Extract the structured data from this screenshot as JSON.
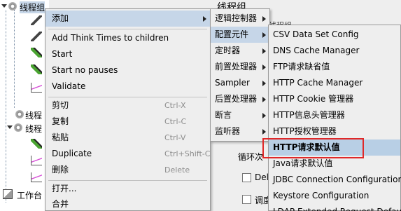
{
  "tree": {
    "top_node_label": "线程组",
    "node_2_label": "线程",
    "node_3_label": "线程",
    "workbench_label": "工作台"
  },
  "right_panel": {
    "title": "线程组",
    "name_label": "线程组",
    "loop_label": "循环次",
    "check_1_label": "Del",
    "check_2_label": "调度"
  },
  "main_menu": {
    "items": [
      {
        "label": "添加"
      },
      {
        "label": "Add Think Times to children"
      },
      {
        "label": "Start"
      },
      {
        "label": "Start no pauses"
      },
      {
        "label": "Validate"
      },
      {
        "label": "剪切",
        "shortcut": "Ctrl-X"
      },
      {
        "label": "复制",
        "shortcut": "Ctrl-C"
      },
      {
        "label": "粘贴",
        "shortcut": "Ctrl-V"
      },
      {
        "label": "Duplicate",
        "shortcut": "Ctrl+Shift-C"
      },
      {
        "label": "删除",
        "shortcut": "Delete"
      },
      {
        "label": "打开..."
      },
      {
        "label": "合并"
      }
    ]
  },
  "sub_menu": {
    "items": [
      {
        "label": "逻辑控制器"
      },
      {
        "label": "配置元件"
      },
      {
        "label": "定时器"
      },
      {
        "label": "前置处理器"
      },
      {
        "label": "Sampler"
      },
      {
        "label": "后置处理器"
      },
      {
        "label": "断言"
      },
      {
        "label": "监听器"
      }
    ]
  },
  "config_menu": {
    "items": [
      {
        "label": "CSV Data Set Config"
      },
      {
        "label": "DNS Cache Manager"
      },
      {
        "label": "FTP请求缺省值"
      },
      {
        "label": "HTTP Cache Manager"
      },
      {
        "label": "HTTP Cookie 管理器"
      },
      {
        "label": "HTTP信息头管理器"
      },
      {
        "label": "HTTP授权管理器"
      },
      {
        "label": "HTTP请求默认值"
      },
      {
        "label": "Java请求默认值"
      },
      {
        "label": "JDBC Connection Configuration"
      },
      {
        "label": "Keystore Configuration"
      },
      {
        "label": "LDAP Extended Request Defaults"
      }
    ]
  },
  "colors": {
    "menu_bg": "#eeeeee",
    "hover_bg": "#c6d6e8",
    "selected_bg": "#b8cfe5",
    "highlight_border": "#e02828"
  }
}
